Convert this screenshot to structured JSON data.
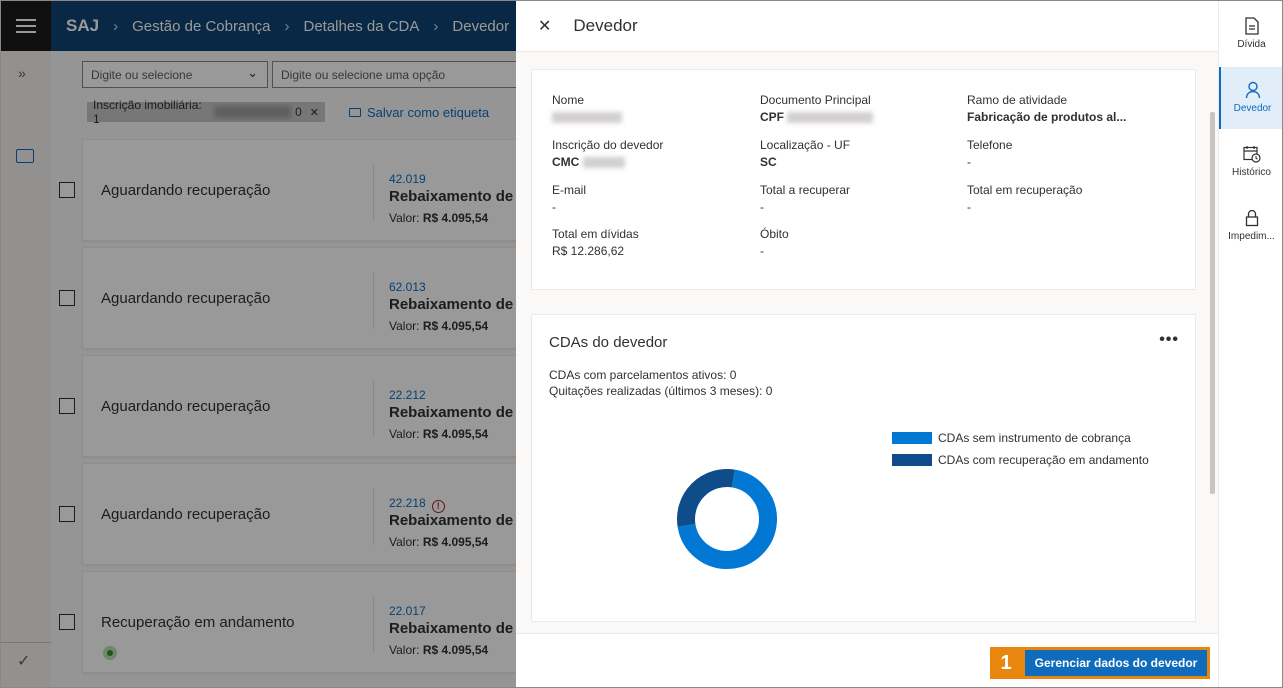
{
  "header": {
    "brand": "SAJ",
    "breadcrumbs": [
      "Gestão de Cobrança",
      "Detalhes da CDA",
      "Devedor"
    ]
  },
  "filters": {
    "select_placeholder": "Digite ou selecione",
    "option_placeholder": "Digite ou selecione uma opção",
    "chip_label": "Inscrição imobiliária: 1",
    "chip_suffix": "0",
    "save_tag": "Salvar como etiqueta"
  },
  "cards": [
    {
      "status": "Aguardando recuperação",
      "number": "42.019",
      "title": "Rebaixamento de gu",
      "value_label": "Valor:",
      "value": "R$ 4.095,54",
      "alert": false,
      "green": false
    },
    {
      "status": "Aguardando recuperação",
      "number": "62.013",
      "title": "Rebaixamento de gu",
      "value_label": "Valor:",
      "value": "R$ 4.095,54",
      "alert": false,
      "green": false
    },
    {
      "status": "Aguardando recuperação",
      "number": "22.212",
      "title": "Rebaixamento de gu",
      "value_label": "Valor:",
      "value": "R$ 4.095,54",
      "alert": false,
      "green": false
    },
    {
      "status": "Aguardando recuperação",
      "number": "22.218",
      "title": "Rebaixamento de gu",
      "value_label": "Valor:",
      "value": "R$ 4.095,54",
      "alert": true,
      "green": false
    },
    {
      "status": "Recuperação em andamento",
      "number": "22.017",
      "title": "Rebaixamento de gu",
      "value_label": "Valor:",
      "value": "R$ 4.095,54",
      "alert": false,
      "green": true
    }
  ],
  "panel": {
    "title": "Devedor",
    "fields": {
      "nome_label": "Nome",
      "doc_label": "Documento Principal",
      "doc_prefix": "CPF",
      "ramo_label": "Ramo de atividade",
      "ramo_value": "Fabricação de produtos al...",
      "inscricao_label": "Inscrição do devedor",
      "inscricao_prefix": "CMC",
      "local_label": "Localização - UF",
      "local_value": "SC",
      "telefone_label": "Telefone",
      "telefone_value": "-",
      "email_label": "E-mail",
      "email_value": "-",
      "total_recuperar_label": "Total a recuperar",
      "total_recuperar_value": "-",
      "total_recuperacao_label": "Total em recuperação",
      "total_recuperacao_value": "-",
      "total_dividas_label": "Total em dívidas",
      "total_dividas_value": "R$ 12.286,62",
      "obito_label": "Óbito",
      "obito_value": "-"
    },
    "cdas": {
      "title": "CDAs do devedor",
      "more": "•••",
      "parcelamentos": "CDAs com parcelamentos ativos: 0",
      "quitacoes": "Quitações realizadas (últimos 3 meses): 0"
    },
    "manage_step": "1",
    "manage_button": "Gerenciar dados do devedor"
  },
  "chart_data": {
    "type": "pie",
    "series": [
      {
        "name": "CDAs sem instrumento de cobrança",
        "value": 70,
        "color": "#0078d4"
      },
      {
        "name": "CDAs com recuperação em andamento",
        "value": 30,
        "color": "#0f4c8a"
      }
    ]
  },
  "right_rail": {
    "tabs": [
      {
        "label": "Dívida",
        "icon": "document-icon"
      },
      {
        "label": "Devedor",
        "icon": "person-icon"
      },
      {
        "label": "Histórico",
        "icon": "calendar-clock-icon"
      },
      {
        "label": "Impedim...",
        "icon": "lock-icon"
      }
    ]
  },
  "colors": {
    "header": "#0f4373",
    "accent": "#0f6cbd",
    "highlight": "#e8860f"
  }
}
